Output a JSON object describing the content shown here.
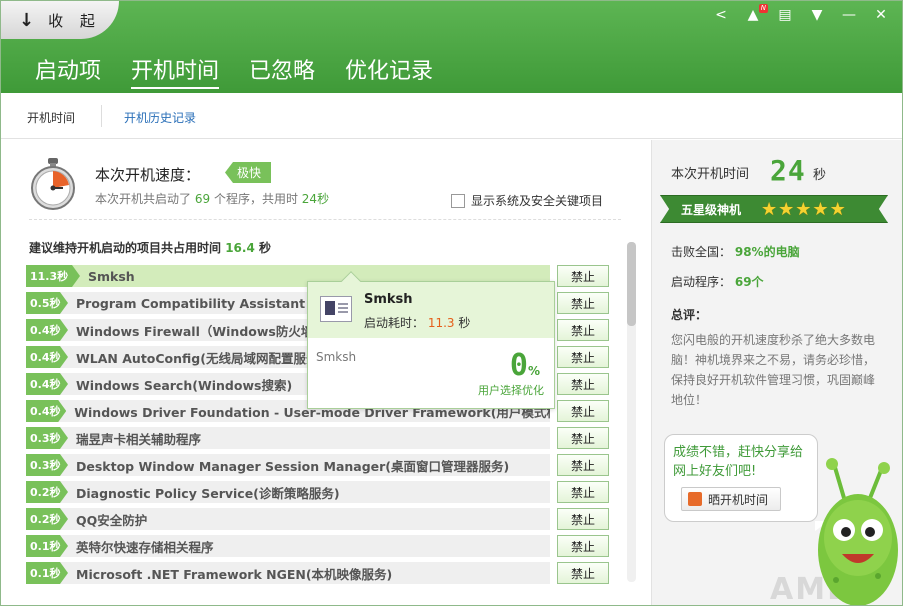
{
  "header": {
    "collapse_label": "收 起",
    "tabs": [
      {
        "label": "启动项"
      },
      {
        "label": "开机时间"
      },
      {
        "label": "已忽略"
      },
      {
        "label": "优化记录"
      }
    ]
  },
  "subnav": {
    "items": [
      {
        "label": "开机时间"
      },
      {
        "label": "开机历史记录"
      }
    ]
  },
  "summary": {
    "title": "本次开机速度：",
    "badge": "极快",
    "desc_prefix": "本次开机共启动了",
    "count": "69",
    "desc_mid": "个程序，共用时",
    "time": "24秒",
    "show_sys_label": "显示系统及安全关键项目"
  },
  "suggest": {
    "prefix": "建议维持开机启动的项目共占用时间",
    "value": "16.4",
    "suffix": "秒"
  },
  "ban_label": "禁止",
  "items": [
    {
      "time": "11.3秒",
      "name": "Smksh"
    },
    {
      "time": "0.5秒",
      "name": "Program Compatibility Assistant Service"
    },
    {
      "time": "0.4秒",
      "name": "Windows Firewall（Windows防火墙服务）"
    },
    {
      "time": "0.4秒",
      "name": "WLAN AutoConfig(无线局域网配置服务)"
    },
    {
      "time": "0.4秒",
      "name": "Windows Search(Windows搜索)"
    },
    {
      "time": "0.4秒",
      "name": "Windows Driver Foundation - User-mode Driver Framework(用户模式框..."
    },
    {
      "time": "0.3秒",
      "name": "瑞昱声卡相关辅助程序"
    },
    {
      "time": "0.3秒",
      "name": "Desktop Window Manager Session Manager(桌面窗口管理器服务)"
    },
    {
      "time": "0.2秒",
      "name": "Diagnostic Policy Service(诊断策略服务)"
    },
    {
      "time": "0.2秒",
      "name": "QQ安全防护"
    },
    {
      "time": "0.1秒",
      "name": "英特尔快速存储相关程序"
    },
    {
      "time": "0.1秒",
      "name": "Microsoft .NET Framework NGEN(本机映像服务)"
    }
  ],
  "tooltip": {
    "name": "Smksh",
    "time_label": "启动耗时：",
    "time_value": "11.3",
    "time_unit": "秒",
    "process": "Smksh",
    "percent": "0",
    "percent_unit": "%",
    "user_choice": "用户选择优化"
  },
  "right": {
    "boot_label": "本次开机时间",
    "boot_value": "24",
    "boot_unit": "秒",
    "rank": "五星级神机",
    "stars": "★★★★★",
    "beat_label": "击败全国：",
    "beat_value": "98%的电脑",
    "prog_label": "启动程序：",
    "prog_value": "69个",
    "review_label": "总评：",
    "review_text": "您闪电般的开机速度秒杀了绝大多数电脑！神机境界来之不易，请务必珍惜，保持良好开机软件管理习惯，巩固巅峰地位！",
    "share_text": "成绩不错，赶快分享给网上好友们吧!",
    "share_button": "晒开机时间",
    "watermark": "AMD"
  },
  "colors": {
    "header_green": "#4aa642",
    "accent_green": "#4aa53a",
    "bar_green": "#79c15a",
    "orange": "#e55f1a"
  }
}
